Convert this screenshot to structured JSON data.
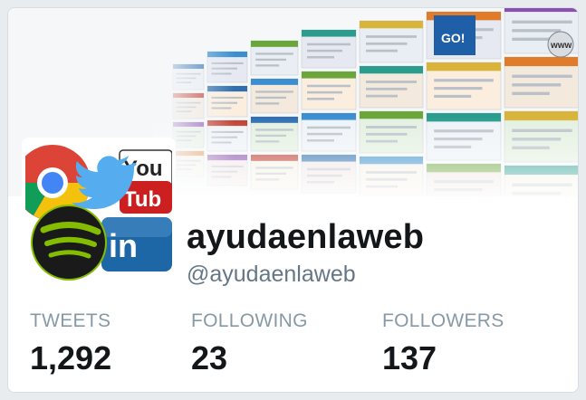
{
  "profile": {
    "display_name": "ayudaenlaweb",
    "handle": "@ayudaenlaweb"
  },
  "stats": {
    "tweets": {
      "label": "TWEETS",
      "value": "1,292"
    },
    "following": {
      "label": "FOLLOWING",
      "value": "23"
    },
    "followers": {
      "label": "FOLLOWERS",
      "value": "137"
    }
  },
  "avatar": {
    "icons": [
      "chrome-icon",
      "twitter-bird-icon",
      "youtube-logo-icon",
      "spotify-icon",
      "linkedin-icon"
    ],
    "youtube_text_1": "You",
    "youtube_text_2": "Tub",
    "linkedin_text": "in"
  },
  "banner": {
    "go_text": "GO!",
    "www_text": "www"
  }
}
